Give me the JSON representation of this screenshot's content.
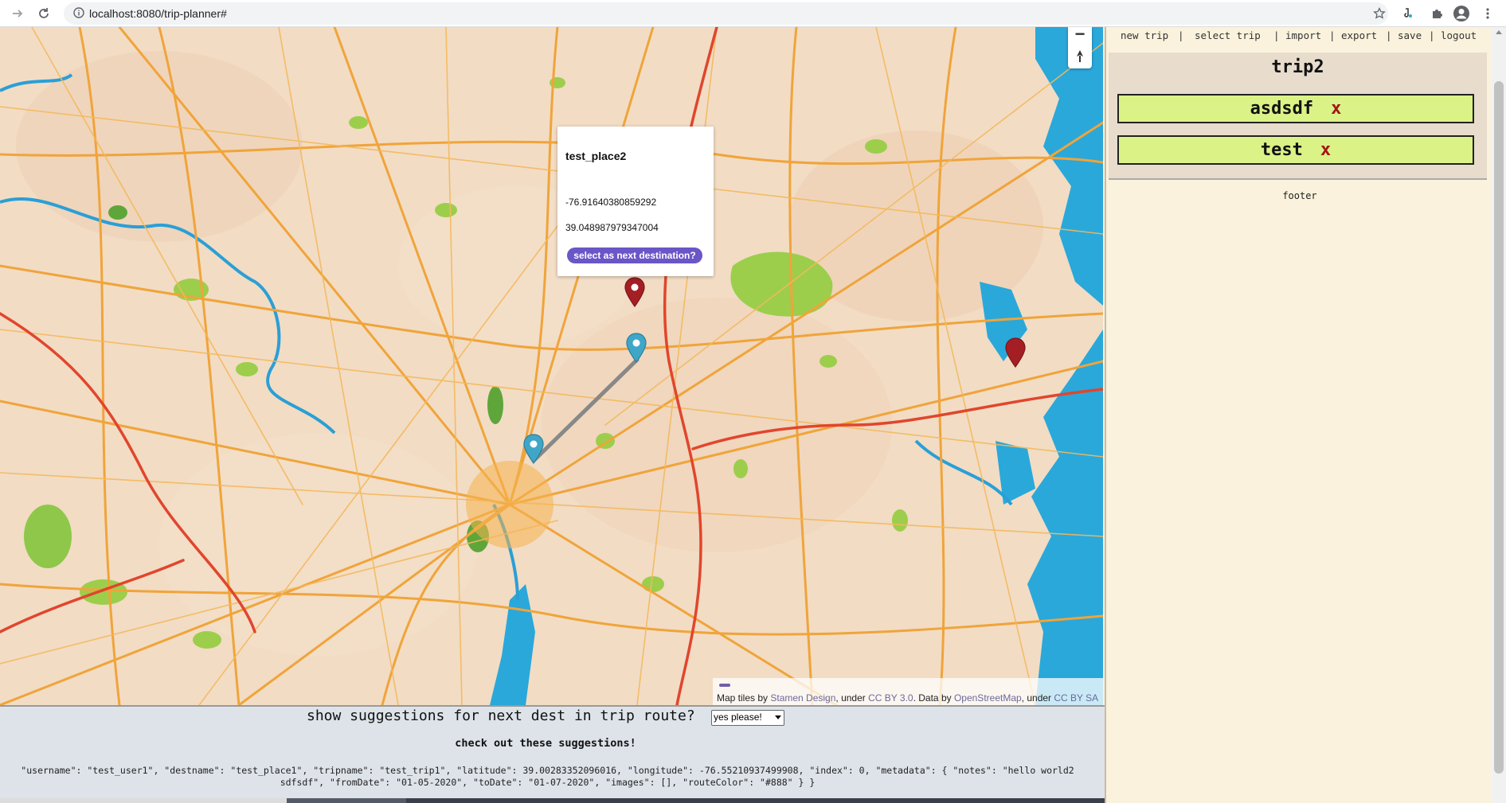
{
  "browser": {
    "url": "localhost:8080/trip-planner#",
    "icons": [
      "forward-arrow-icon",
      "reload-icon",
      "info-icon",
      "star-icon",
      "extension-icon",
      "puzzle-icon",
      "profile-icon",
      "menu-icon"
    ]
  },
  "map": {
    "popup": {
      "title": "test_place2",
      "longitude": "-76.91640380859292",
      "latitude": "39.048987979347004",
      "button_label": "select as next destination?"
    },
    "zoom_out_label": "−",
    "attribution": {
      "prefix": "Map tiles by ",
      "stamen": "Stamen Design",
      "under1": ", under ",
      "cc30": "CC BY 3.0",
      "data_by": ". Data by ",
      "osm": "OpenStreetMap",
      "under2": ", under ",
      "ccsa": "CC BY SA"
    },
    "colors": {
      "route_line": "#888888",
      "marker_red": "#a31f24",
      "marker_blue": "#3fa6c8",
      "water": "#2aa7d8"
    }
  },
  "sidebar": {
    "nav": {
      "new_trip": "new trip",
      "select_trip": "select trip",
      "import": "import",
      "export": "export",
      "save": "save",
      "logout": "logout",
      "separator": "|"
    },
    "trip_title": "trip2",
    "destinations": [
      {
        "name": "asdsdf",
        "remove": "x"
      },
      {
        "name": "test",
        "remove": "x"
      }
    ],
    "footer": "footer"
  },
  "suggestions": {
    "question": "show suggestions for next dest in trip route?",
    "select_value": "yes please!",
    "heading": "check out these suggestions!",
    "json_line1": "\"username\": \"test_user1\", \"destname\": \"test_place1\", \"tripname\": \"test_trip1\", \"latitude\": 39.00283352096016, \"longitude\": -76.55210937499908, \"index\": 0, \"metadata\": { \"notes\": \"hello world2",
    "json_line2": "sdfsdf\", \"fromDate\": \"01-05-2020\", \"toDate\": \"01-07-2020\", \"images\": [], \"routeColor\": \"#888\" } }"
  }
}
